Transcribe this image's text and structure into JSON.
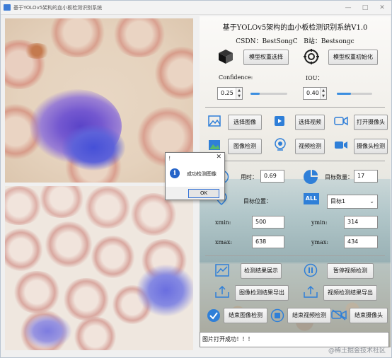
{
  "window": {
    "title": "基于YOLOv5架构的血小板检测识别系统",
    "controls": [
      "—",
      "□",
      "✕"
    ]
  },
  "images": {
    "top": "original-blood-smear-image",
    "bottom": "detection-result-image"
  },
  "header": {
    "title": "基于YOLOv5架构的血小板检测识别系统V1.0",
    "csdn_label": "CSDN：",
    "csdn_value": "BestSongC",
    "bili_label": "B站：",
    "bili_value": "Bestsongc"
  },
  "model": {
    "select_button": "模型权重选择",
    "init_button": "模型权重初始化"
  },
  "params": {
    "confidence_label": "Confidence:",
    "confidence_value": "0.25",
    "confidence_fraction": 0.25,
    "iou_label": "IOU：",
    "iou_value": "0.40",
    "iou_fraction": 0.4
  },
  "actions": {
    "select_image": "选择图像",
    "select_video": "选择视频",
    "open_camera": "打开摄像头",
    "image_detect": "图像检测",
    "video_detect": "视频检测",
    "camera_detect": "摄像头检测"
  },
  "results": {
    "time_label": "用时：",
    "time_value": "0.69",
    "count_label": "目标数量：",
    "count_value": "17",
    "position_label": "目标位置：",
    "target_select": "目标1",
    "xmin_label": "xmin:",
    "xmin_value": "500",
    "ymin_label": "ymin:",
    "ymin_value": "314",
    "xmax_label": "xmax:",
    "xmax_value": "638",
    "ymax_label": "ymax:",
    "ymax_value": "434"
  },
  "bottom_actions": {
    "show_results": "检测结果展示",
    "pause_video": "暂停视频检测",
    "export_image": "图像检测结果导出",
    "export_video": "视频检测结果导出",
    "end_image": "结束图像检测",
    "end_video": "结束视频检测",
    "end_camera": "结束摄像头"
  },
  "status": {
    "message": "图片打开成功！！！",
    "watermark": "@稀土掘金技术社区"
  },
  "dialog": {
    "title": "！",
    "close": "✕",
    "message": "成功检测图像",
    "ok": "OK"
  },
  "colors": {
    "accent": "#2f7fd8",
    "slider_fill": "#3b8ee0",
    "info_icon": "#2564c9"
  }
}
